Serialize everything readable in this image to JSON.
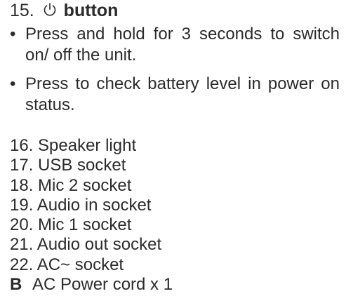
{
  "heading": {
    "number": "15.",
    "icon": "power-icon",
    "title": "button"
  },
  "bullets": [
    "Press and hold for 3 seconds to switch on/ off the unit.",
    "Press to check battery level in power on status."
  ],
  "bullet_symbol": "•",
  "items": [
    "16. Speaker light",
    "17. USB socket",
    "18. Mic 2 socket",
    "19. Audio in socket",
    "20. Mic 1 socket",
    "21. Audio out socket",
    "22. AC~ socket"
  ],
  "final_item": {
    "marker": "B",
    "text": "AC Power cord x 1"
  }
}
